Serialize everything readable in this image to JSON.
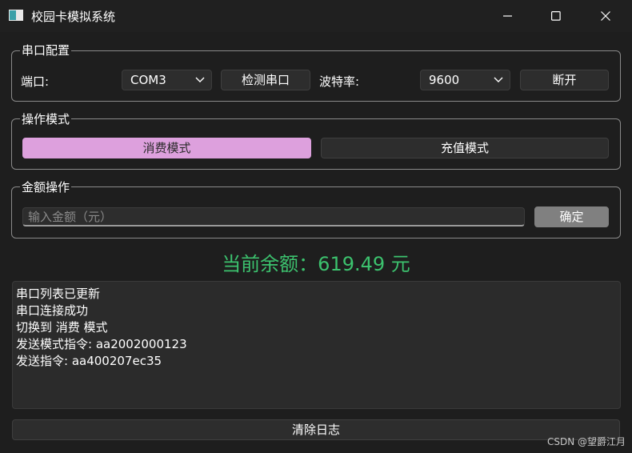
{
  "window": {
    "title": "校园卡模拟系统",
    "controls": [
      "minimize-icon",
      "maximize-icon",
      "close-icon"
    ]
  },
  "serial_config": {
    "group_label": "串口配置",
    "port_label": "端口:",
    "port_value": "COM3",
    "detect_button": "检测串口",
    "baud_label": "波特率:",
    "baud_value": "9600",
    "disconnect_button": "断开"
  },
  "operation_mode": {
    "group_label": "操作模式",
    "consume_button": "消费模式",
    "recharge_button": "充值模式",
    "selected": "consume"
  },
  "amount_operation": {
    "group_label": "金额操作",
    "input_placeholder": "输入金额（元）",
    "input_value": "",
    "confirm_button": "确定"
  },
  "balance_text": "当前余额：619.49 元",
  "log": {
    "lines": [
      "串口列表已更新",
      "串口连接成功",
      "切换到 消费 模式",
      "发送模式指令: aa2002000123",
      "发送指令: aa400207ec35"
    ]
  },
  "clear_log_button": "清除日志",
  "watermark": "CSDN @望爵江月",
  "colors": {
    "background": "#1e1e1e",
    "selected_mode": "#dda0dd",
    "balance": "#3cc26e",
    "confirm": "#808080"
  }
}
